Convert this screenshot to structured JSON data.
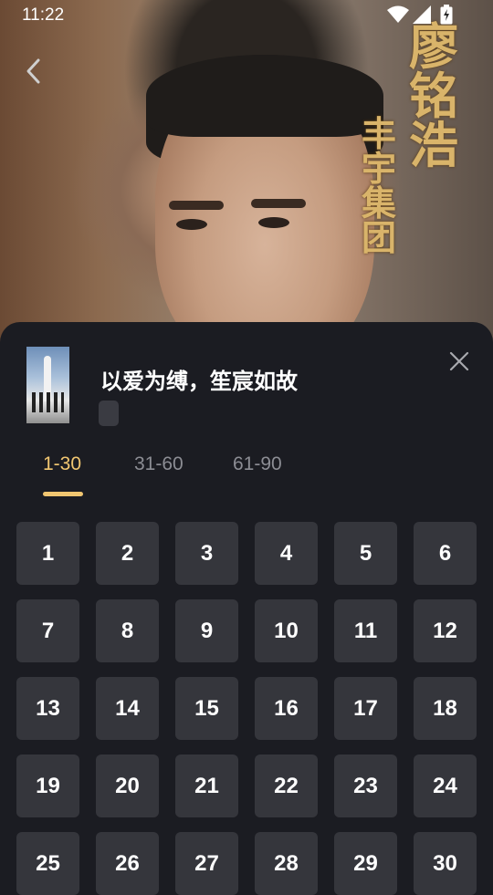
{
  "status_bar": {
    "time": "11:22"
  },
  "hero": {
    "calligraphy_main": "廖铭浩",
    "calligraphy_sub": "丰宇集团"
  },
  "episode_panel": {
    "title": "以爱为缚，笙宸如故",
    "tabs": [
      {
        "label": "1-30",
        "active": true
      },
      {
        "label": "31-60",
        "active": false
      },
      {
        "label": "61-90",
        "active": false
      }
    ],
    "episodes": [
      "1",
      "2",
      "3",
      "4",
      "5",
      "6",
      "7",
      "8",
      "9",
      "10",
      "11",
      "12",
      "13",
      "14",
      "15",
      "16",
      "17",
      "18",
      "19",
      "20",
      "21",
      "22",
      "23",
      "24",
      "25",
      "26",
      "27",
      "28",
      "29",
      "30"
    ]
  },
  "colors": {
    "accent": "#f1c671",
    "sheet_bg": "#1b1c22",
    "cell_bg": "#35363c"
  },
  "icons": [
    "back-arrow-icon",
    "wifi-icon",
    "signal-icon",
    "battery-icon",
    "close-icon"
  ]
}
